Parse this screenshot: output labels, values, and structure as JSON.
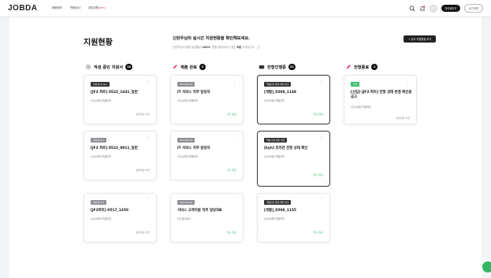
{
  "header": {
    "logo": "JOBDA",
    "nav": [
      "채용정보",
      "역량검사",
      "취업지원"
    ],
    "nav_beta": "BETA",
    "actions": {
      "mypage": "마이페이지",
      "logout": "로그아웃"
    }
  },
  "page": {
    "title": "지원현황",
    "headline": "신란우님의 실시간 지원현황을 확인해보세요.",
    "sub_prefix": "신란우님의 종합 달성률은 ",
    "sub_rate": "100%",
    "sub_mid": ", 종합 응답속도는 평균 ",
    "sub_speed": "8일",
    "sub_suffix": " 이내입니다.",
    "register_button": "+ 공고 지원현황 추가"
  },
  "columns": [
    {
      "title": "작성 중인 지원서",
      "count": "18"
    },
    {
      "title": "제출 완료",
      "count": "3"
    },
    {
      "title": "전형진행중",
      "count": "31"
    },
    {
      "title": "전형종료",
      "count": "1"
    }
  ],
  "cards": [
    {
      "tag": "작성 중 D-day",
      "title": "[JF3 파트] 0522_1431_일반",
      "company": "(주)씨에이치엘리미",
      "status": "공채마감 이전"
    },
    {
      "tag": "2023-05-19",
      "title": "IT 서비스 직무 담당자",
      "company": "(주)씨에이치엘리미",
      "status": "접수 완료"
    },
    {
      "tag": "역량검사 결과 확인 대기",
      "title": "[개발]_0508_1149",
      "company": "(주)씨에이치엘리미",
      "status": "접수 완료"
    },
    {
      "tag": "합격",
      "title": "[신입] [JF3 파트] 전형 상태 변경 확인용 공고",
      "company": "(주)씨에이치엘리미",
      "status": "공채마감 이전"
    },
    {
      "tag": "작성 중 D-3",
      "title": "[JF3 파트] 0522_0911_일반",
      "company": "(주)씨에이치엘리미",
      "status": "공채마감 이전"
    },
    {
      "tag": "2023-05-18",
      "title": "IT 서비스 직무 담당자",
      "company": "(주)씨에이치엘리미",
      "status": "접수 완료"
    },
    {
      "tag": "역량 검사 제출 필요",
      "title": "[kyh] 유지연 전형 상태 확인",
      "company": "(주)씨에이치엘리미",
      "status": "접수 완료"
    },
    {
      "tag": "작성 중 D-5",
      "title": "[JF3파트] 0517_1250",
      "company": "(주)씨에이치엘리미",
      "status": "공채마감 이전"
    },
    {
      "tag": "2023-05-16",
      "title": "서비스 고객지원 직무 담당자B",
      "company": "(주)잡다테크",
      "status": "접수 완료"
    },
    {
      "tag": "역량검사 결과 확인 대기",
      "title": "[개발]_0508_1155",
      "company": "(주)씨에이치엘리미",
      "status": "접수 완료"
    }
  ],
  "colors": {
    "accent_green": "#3bbf6e",
    "dark": "#111111",
    "background": "#f3f4f6"
  }
}
